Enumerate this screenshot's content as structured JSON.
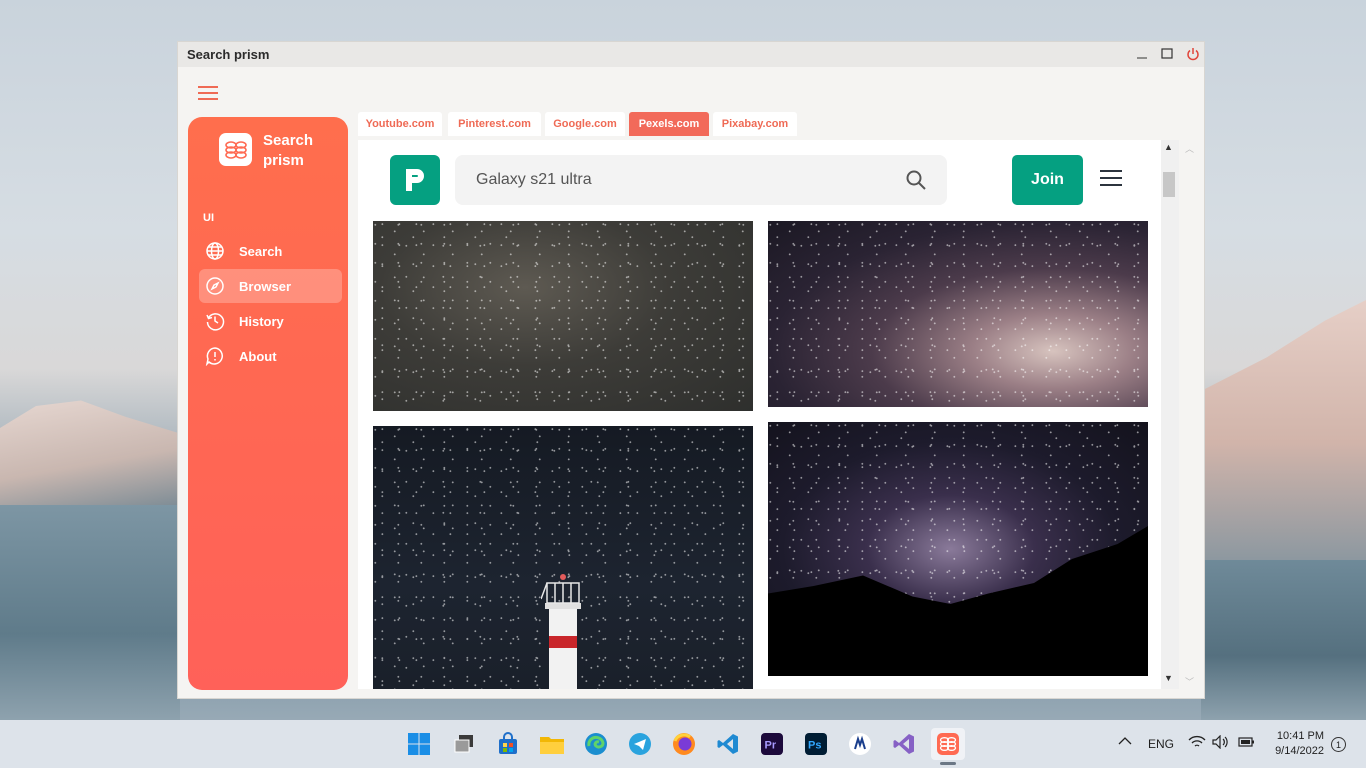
{
  "window": {
    "title": "Search prism"
  },
  "sidebar": {
    "app_name": "Search prism",
    "section_label": "UI",
    "items": [
      {
        "label": "Search",
        "icon": "globe-icon",
        "active": false
      },
      {
        "label": "Browser",
        "icon": "compass-icon",
        "active": true
      },
      {
        "label": "History",
        "icon": "history-icon",
        "active": false
      },
      {
        "label": "About",
        "icon": "info-icon",
        "active": false
      }
    ]
  },
  "tabs": [
    {
      "label": "Youtube.com",
      "active": false
    },
    {
      "label": "Pinterest.com",
      "active": false
    },
    {
      "label": "Google.com",
      "active": false
    },
    {
      "label": "Pexels.com",
      "active": true
    },
    {
      "label": "Pixabay.com",
      "active": false
    }
  ],
  "pexels": {
    "search_value": "Galaxy s21 ultra",
    "join_label": "Join",
    "brand_color": "#05a081"
  },
  "photos": [
    {
      "subject": "milky-way-starfield"
    },
    {
      "subject": "milky-way-core"
    },
    {
      "subject": "lighthouse-night-sky"
    },
    {
      "subject": "milky-way-over-mountain"
    }
  ],
  "taskbar": {
    "apps": [
      "windows-start-icon",
      "task-view-icon",
      "store-icon",
      "file-explorer-icon",
      "edge-icon",
      "telegram-icon",
      "firefox-icon",
      "vscode-icon",
      "premiere-icon",
      "photoshop-icon",
      "generic-app-icon",
      "visual-studio-icon",
      "search-prism-icon"
    ],
    "language": "ENG",
    "time": "10:41 PM",
    "date": "9/14/2022",
    "notifications": "1"
  },
  "colors": {
    "accent": "#ff6a52",
    "sidebar_top": "#ff6e4d",
    "sidebar_bottom": "#ff6159"
  }
}
